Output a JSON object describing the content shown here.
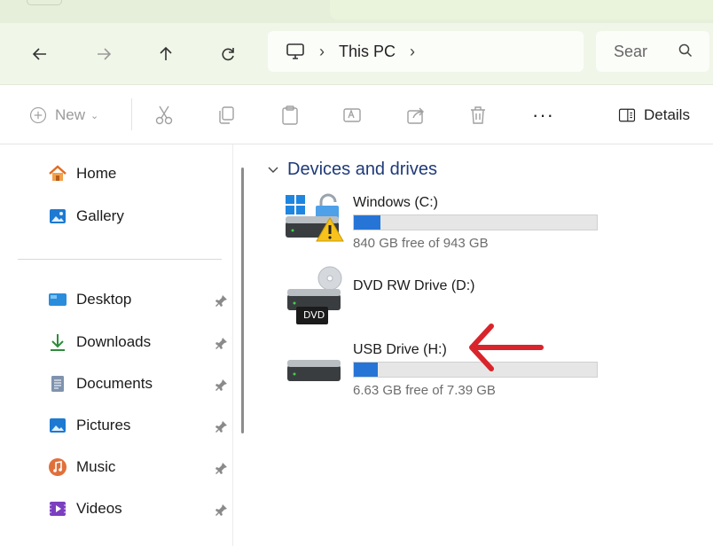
{
  "nav": {
    "address_parts": [
      "This PC"
    ],
    "search_placeholder": "Sear"
  },
  "commands": {
    "new_label": "New",
    "details_label": "Details"
  },
  "sidebar": {
    "items": [
      {
        "label": "Home",
        "pinned": false
      },
      {
        "label": "Gallery",
        "pinned": false
      },
      {
        "label": "Desktop",
        "pinned": true
      },
      {
        "label": "Downloads",
        "pinned": true
      },
      {
        "label": "Documents",
        "pinned": true
      },
      {
        "label": "Pictures",
        "pinned": true
      },
      {
        "label": "Music",
        "pinned": true
      },
      {
        "label": "Videos",
        "pinned": true
      }
    ]
  },
  "main": {
    "section_title": "Devices and drives",
    "drives": [
      {
        "name": "Windows (C:)",
        "free_text": "840 GB free of 943 GB",
        "used_fraction": 0.11
      },
      {
        "name": "DVD RW Drive (D:)",
        "badge": "DVD"
      },
      {
        "name": "USB Drive (H:)",
        "free_text": "6.63 GB free of 7.39 GB",
        "used_fraction": 0.1
      }
    ]
  },
  "colors": {
    "accent": "#2675d6",
    "annotation_arrow": "#d9242b",
    "section_title": "#1f3a78",
    "nav_background": "#f0f6e8"
  },
  "icons": {
    "back": "arrow-left-icon",
    "forward": "arrow-right-icon",
    "up": "arrow-up-icon",
    "refresh": "refresh-icon",
    "computer": "monitor-icon",
    "search": "search-icon"
  }
}
